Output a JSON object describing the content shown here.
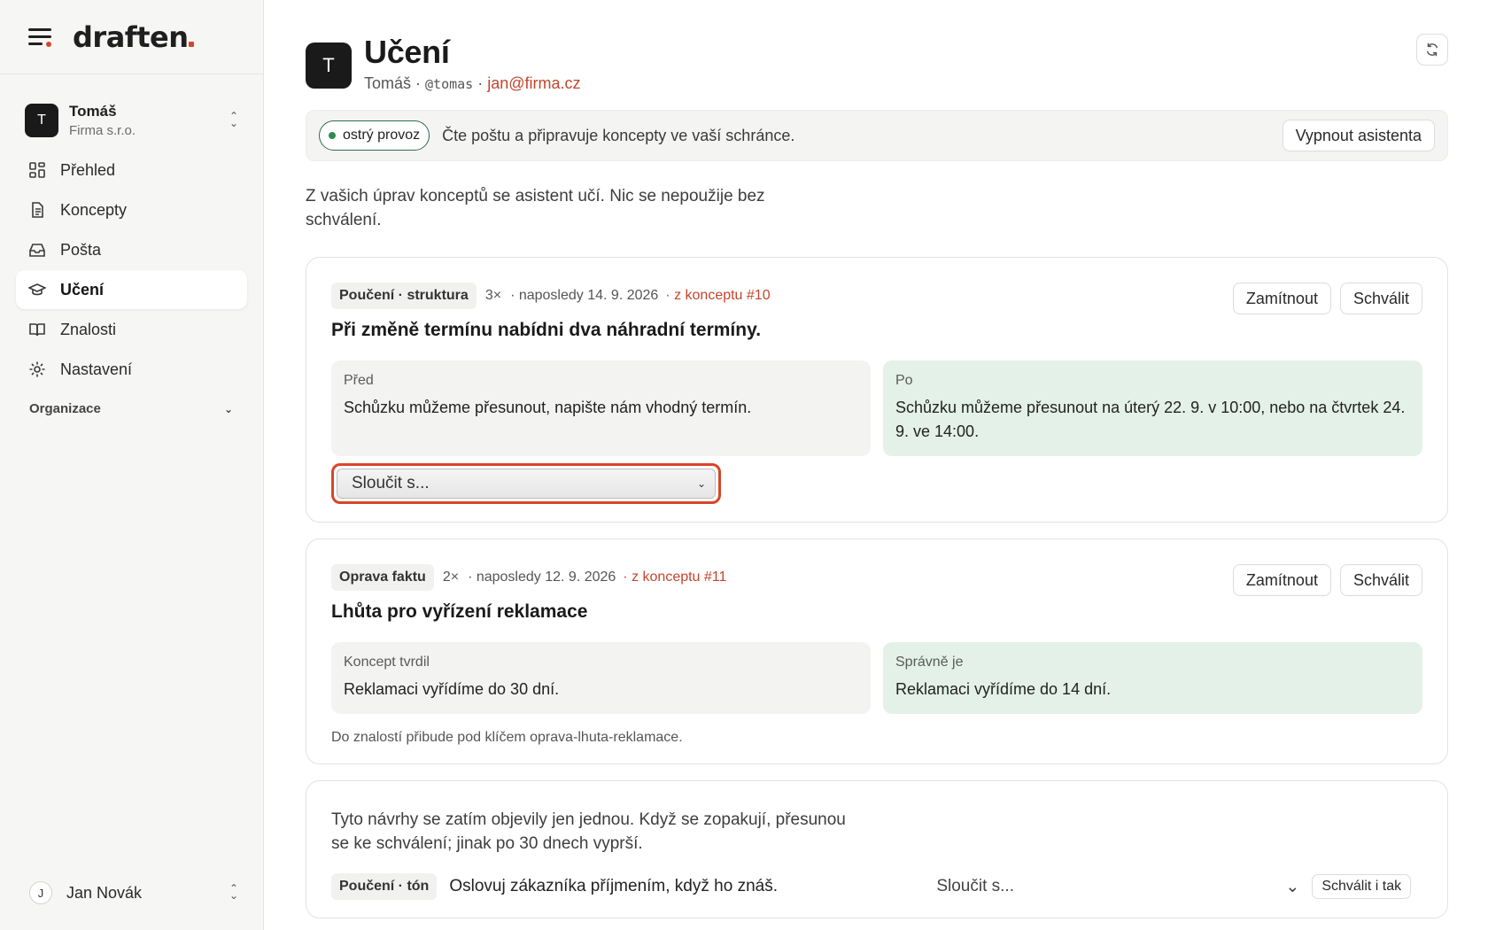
{
  "brand": {
    "logo_text": "draften"
  },
  "org": {
    "avatar": "T",
    "name": "Tomáš",
    "company": "Firma s.r.o."
  },
  "nav": {
    "items": [
      {
        "label": "Přehled",
        "icon": "grid-icon"
      },
      {
        "label": "Koncepty",
        "icon": "document-icon"
      },
      {
        "label": "Pošta",
        "icon": "inbox-icon"
      },
      {
        "label": "Učení",
        "icon": "graduation-cap-icon",
        "active": true
      },
      {
        "label": "Znalosti",
        "icon": "book-icon"
      },
      {
        "label": "Nastavení",
        "icon": "gear-icon"
      }
    ],
    "section_label": "Organizace"
  },
  "user": {
    "avatar": "J",
    "name": "Jan Novák"
  },
  "header": {
    "avatar": "T",
    "title": "Učení",
    "name": "Tomáš",
    "handle": "@tomas",
    "email": "jan@firma.cz"
  },
  "status": {
    "pill": "ostrý provoz",
    "text": "Čte poštu a připravuje koncepty ve vaší schránce.",
    "button": "Vypnout asistenta"
  },
  "intro": "Z vašich úprav konceptů se asistent učí. Nic se nepoužije bez schválení.",
  "cards": [
    {
      "tag": "Poučení · struktura",
      "count": "3×",
      "last": "· naposledy 14. 9. 2026",
      "source": "· z konceptu #10",
      "title": "Při změně termínu nabídni dva náhradní termíny.",
      "before_label": "Před",
      "before_text": "Schůzku můžeme přesunout, napište nám vhodný termín.",
      "after_label": "Po",
      "after_text": "Schůzku můžeme přesunout na úterý 22. 9. v 10:00, nebo na čtvrtek 24. 9. ve 14:00.",
      "merge_label": "Sloučit s...",
      "reject": "Zamítnout",
      "approve": "Schválit"
    },
    {
      "tag": "Oprava faktu",
      "count": "2×",
      "last": "· naposledy 12. 9. 2026",
      "source": "· z konceptu #11",
      "title": "Lhůta pro vyřízení reklamace",
      "before_label": "Koncept tvrdil",
      "before_text": "Reklamaci vyřídíme do 30 dní.",
      "after_label": "Správně je",
      "after_text": "Reklamaci vyřídíme do 14 dní.",
      "note": "Do znalostí přibude pod klíčem oprava-lhuta-reklamace.",
      "reject": "Zamítnout",
      "approve": "Schválit"
    }
  ],
  "pending": {
    "text": "Tyto návrhy se zatím objevily jen jednou. Když se zopakují, přesunou se ke schválení; jinak po 30 dnech vyprší.",
    "items": [
      {
        "tag": "Poučení · tón",
        "text": "Oslovuj zákazníka příjmením, když ho znáš.",
        "merge_label": "Sloučit s...",
        "approve": "Schválit i tak"
      }
    ]
  },
  "colors": {
    "accent": "#d9452b",
    "link": "#c4452c",
    "live": "#2e8a55",
    "after_bg": "#e4f1e8"
  }
}
